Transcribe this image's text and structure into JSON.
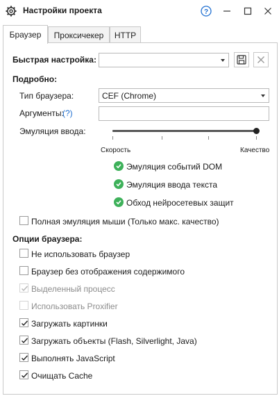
{
  "window": {
    "title": "Настройки проекта"
  },
  "tabs": [
    {
      "label": "Браузер",
      "active": true
    },
    {
      "label": "Проксичекер",
      "active": false
    },
    {
      "label": "HTTP",
      "active": false
    }
  ],
  "quick_settings": {
    "label": "Быстрая настройка:",
    "value": ""
  },
  "details": {
    "heading": "Подробно:",
    "browser_type_label": "Тип браузера:",
    "browser_type_value": "CEF (Chrome)",
    "arguments_label": "Аргументы:",
    "arguments_help": "(?)",
    "arguments_value": "",
    "input_emulation_label": "Эмуляция ввода:",
    "slider_left_label": "Скорость",
    "slider_right_label": "Качество",
    "slider_level": 1.0
  },
  "emulation_features": [
    {
      "label": "Эмуляция событий DOM",
      "enabled": true
    },
    {
      "label": "Эмуляция ввода текста",
      "enabled": true
    },
    {
      "label": "Обход нейросетевых защит",
      "enabled": true
    }
  ],
  "full_mouse_emulation": {
    "label": "Полная эмуляция мыши (Только макс. качество)",
    "checked": false
  },
  "browser_options": {
    "heading": "Опции браузера:",
    "items": [
      {
        "label": "Не использовать браузер",
        "checked": false,
        "disabled": false
      },
      {
        "label": "Браузер без отображения содержимого",
        "checked": false,
        "disabled": false
      },
      {
        "label": "Выделенный процесс",
        "checked": true,
        "disabled": true
      },
      {
        "label": "Использовать Proxifier",
        "checked": false,
        "disabled": true
      },
      {
        "label": "Загружать картинки",
        "checked": true,
        "disabled": false
      },
      {
        "label": "Загружать объекты (Flash, Silverlight, Java)",
        "checked": true,
        "disabled": false
      },
      {
        "label": "Выполнять JavaScript",
        "checked": true,
        "disabled": false
      },
      {
        "label": "Очищать Cache",
        "checked": true,
        "disabled": false
      }
    ]
  },
  "colors": {
    "accent_green": "#3eb15a",
    "help_blue": "#1f6fd1"
  }
}
